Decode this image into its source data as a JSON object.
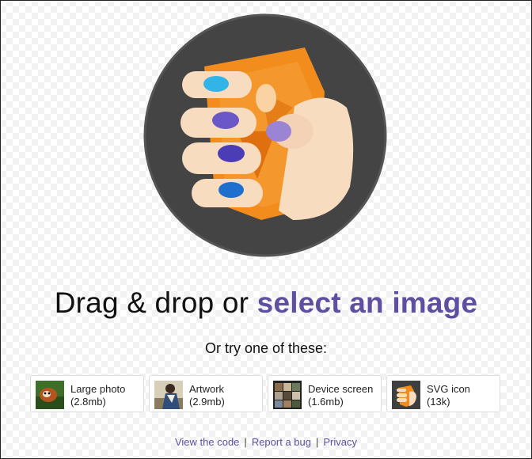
{
  "headline": {
    "prefix": "Drag & drop or",
    "link": "select an image"
  },
  "try_text": "Or try one of these:",
  "samples": [
    {
      "title": "Large photo",
      "size": "(2.8mb)",
      "thumb_icon": "red-panda-photo-thumbnail"
    },
    {
      "title": "Artwork",
      "size": "(2.9mb)",
      "thumb_icon": "painting-thumbnail"
    },
    {
      "title": "Device screen",
      "size": "(1.6mb)",
      "thumb_icon": "phone-screenshot-thumbnail"
    },
    {
      "title": "SVG icon",
      "size": "(13k)",
      "thumb_icon": "logo-svg-thumbnail"
    }
  ],
  "footer": {
    "links": [
      "View the code",
      "Report a bug",
      "Privacy"
    ]
  },
  "colors": {
    "accent": "#5f4fa1",
    "logo_bg": "#3f3f3f",
    "logo_orange": "#f08a1c",
    "text": "#111111"
  }
}
